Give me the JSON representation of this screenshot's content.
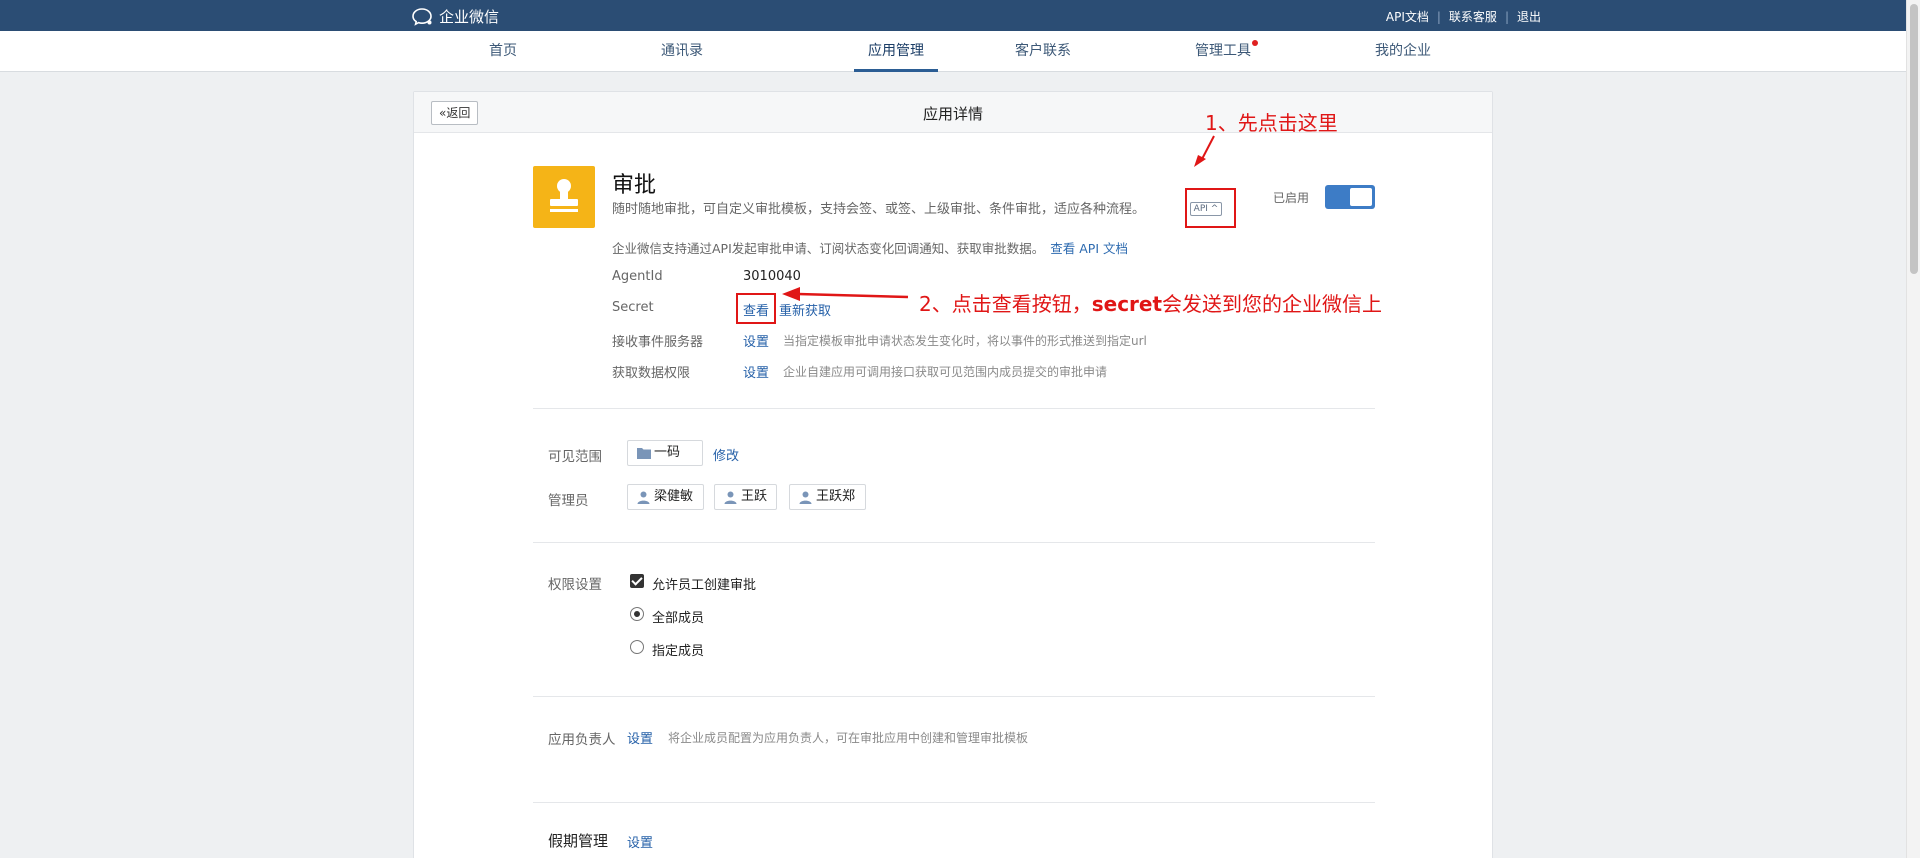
{
  "topbar": {
    "brand": "企业微信",
    "links": [
      "API文档",
      "联系客服",
      "退出"
    ]
  },
  "nav": {
    "items": [
      {
        "label": "首页"
      },
      {
        "label": "通讯录"
      },
      {
        "label": "应用管理",
        "active": true
      },
      {
        "label": "客户联系"
      },
      {
        "label": "管理工具",
        "badge_dot": true
      },
      {
        "label": "我的企业"
      }
    ]
  },
  "card": {
    "back_label": "返回",
    "title": "应用详情"
  },
  "app": {
    "name": "审批",
    "description": "随时随地审批，可自定义审批模板，支持会签、或签、上级审批、条件审批，适应各种流程。",
    "api_badge": "API",
    "api_note": "企业微信支持通过API发起审批申请、订阅状态变化回调通知、获取审批数据。",
    "api_doc_link": "查看 API 文档",
    "status_label": "已启用",
    "enabled": true
  },
  "details": {
    "agentid_label": "AgentId",
    "agentid_value": "3010040",
    "secret_label": "Secret",
    "secret_view": "查看",
    "secret_refresh": "重新获取",
    "event_label": "接收事件服务器",
    "event_link": "设置",
    "event_hint": "当指定模板审批申请状态发生变化时，将以事件的形式推送到指定url",
    "data_label": "获取数据权限",
    "data_link": "设置",
    "data_hint": "企业自建应用可调用接口获取可见范围内成员提交的审批申请"
  },
  "visibility": {
    "label": "可见范围",
    "scope": "一码",
    "edit": "修改"
  },
  "admins": {
    "label": "管理员",
    "people": [
      "梁健敏",
      "王跃",
      "王跃郑"
    ]
  },
  "permissions": {
    "label": "权限设置",
    "allow_create": "允许员工创建审批",
    "allow_create_checked": true,
    "options": [
      {
        "label": "全部成员",
        "selected": true
      },
      {
        "label": "指定成员",
        "selected": false
      }
    ]
  },
  "owner": {
    "label": "应用负责人",
    "link": "设置",
    "hint": "将企业成员配置为应用负责人，可在审批应用中创建和管理审批模板"
  },
  "leave": {
    "label": "假期管理",
    "link": "设置"
  },
  "annotations": {
    "step1": "1、先点击这里",
    "step2_prefix": "2、点击查看按钮，",
    "step2_bold": "secret",
    "step2_suffix": "会发送到您的企业微信上"
  },
  "colors": {
    "topbar": "#2b4d74",
    "accent": "#2560a8",
    "app_icon": "#f5b417",
    "annotation": "#e01616",
    "toggle_on": "#3d7cc6"
  }
}
